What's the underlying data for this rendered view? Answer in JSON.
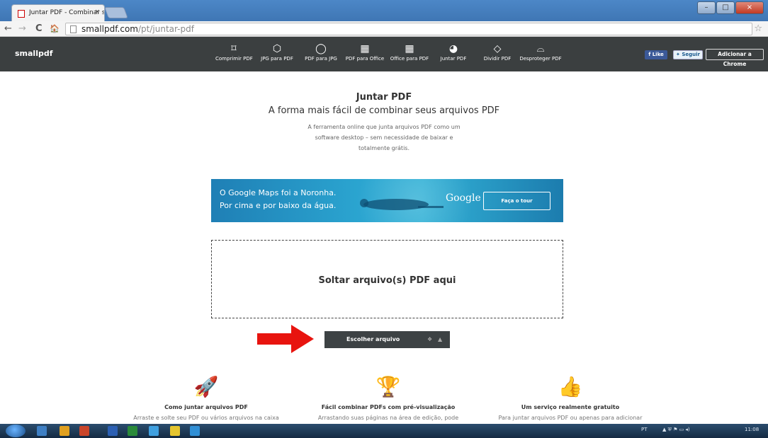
{
  "browser": {
    "tab_title": "Juntar PDF - Combinar se",
    "tab_close": "×",
    "nav_back": "←",
    "nav_forward": "→",
    "nav_reload": "C",
    "nav_home": "🏠",
    "url_host": "smallpdf.com",
    "url_path": "/pt/juntar-pdf",
    "star": "☆"
  },
  "header": {
    "logo": "smallpdf",
    "tools": [
      {
        "label": "Comprimir PDF",
        "icon": "compress-icon",
        "glyph": "⌑"
      },
      {
        "label": "JPG para PDF",
        "icon": "jpg-to-pdf-icon",
        "glyph": "⬡"
      },
      {
        "label": "PDF para JPG",
        "icon": "pdf-to-jpg-icon",
        "glyph": "◯"
      },
      {
        "label": "PDF para Office",
        "icon": "pdf-to-office-icon",
        "glyph": "▦"
      },
      {
        "label": "Office para PDF",
        "icon": "office-to-pdf-icon",
        "glyph": "▦"
      },
      {
        "label": "Juntar PDF",
        "icon": "merge-pdf-icon",
        "glyph": "◕"
      },
      {
        "label": "Dividir PDF",
        "icon": "split-pdf-icon",
        "glyph": "◇"
      },
      {
        "label": "Desproteger PDF",
        "icon": "unlock-pdf-icon",
        "glyph": "⌓"
      }
    ],
    "facebook_like": "Like",
    "twitter_follow": "Seguir",
    "chrome_button": "Adicionar a Chrome"
  },
  "main": {
    "title": "Juntar PDF",
    "subtitle": "A forma mais fácil de combinar seus arquivos PDF",
    "description_lines": [
      "A ferramenta online que junta arquivos PDF como um",
      "software desktop – sem necessidade de baixar e",
      "totalmente grátis."
    ],
    "drop_text": "Soltar arquivo(s) PDF aqui",
    "choose_button": "Escolher arquivo"
  },
  "ad": {
    "line1": "O Google Maps foi a Noronha.",
    "line2": "Por cima e por baixo da água.",
    "brand": "Google",
    "cta": "Faça o tour"
  },
  "features": [
    {
      "title": "Como juntar arquivos PDF",
      "text": "Arraste e solte seu PDF ou vários arquivos na caixa",
      "icon": "rocket-icon",
      "glyph": "🚀"
    },
    {
      "title": "Fácil combinar PDFs com pré-visualização",
      "text": "Arrastando suas páginas na área de edição, pode",
      "icon": "trophy-icon",
      "glyph": "🏆"
    },
    {
      "title": "Um serviço realmente gratuito",
      "text": "Para juntar arquivos PDF ou apenas para adicionar",
      "icon": "thumbs-up-icon",
      "glyph": "👍"
    }
  ],
  "taskbar": {
    "language": "PT",
    "clock": "11:08"
  },
  "colors": {
    "header_bg": "#3b3f40",
    "accent_arrow": "#e8140f",
    "button_bg": "#3d4244"
  }
}
